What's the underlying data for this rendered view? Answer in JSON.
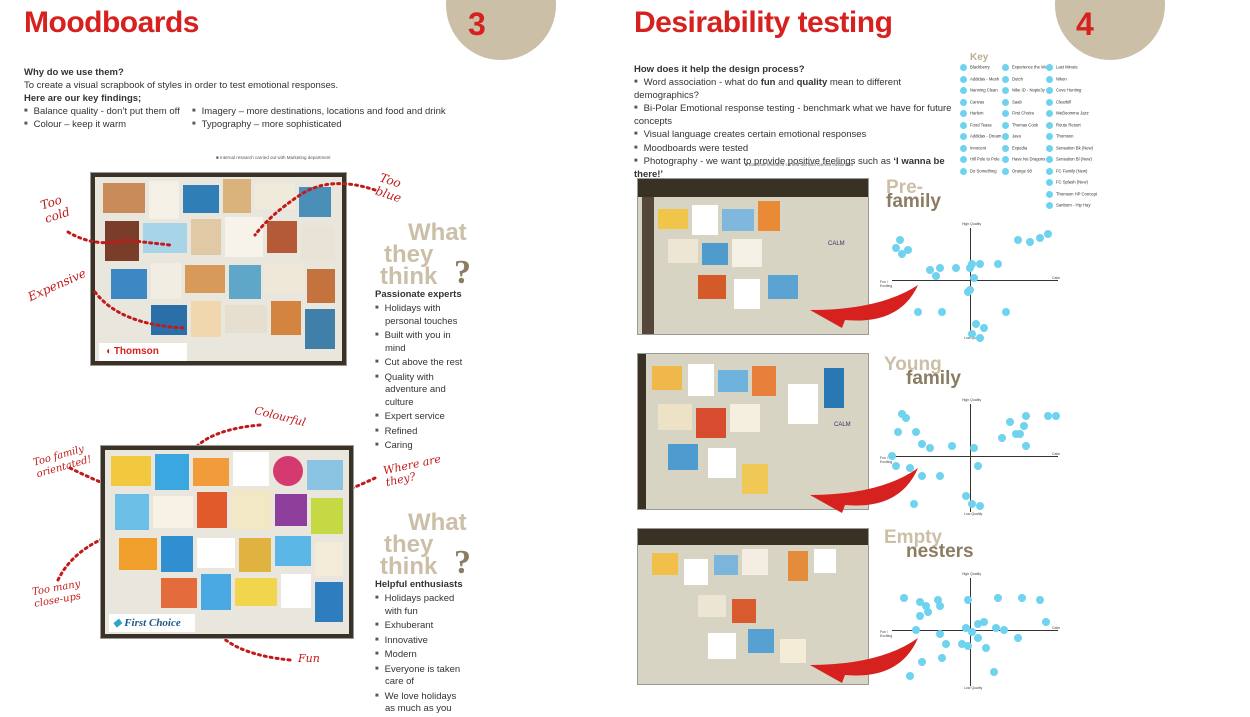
{
  "left": {
    "title": "Moodboards",
    "page_number": "3",
    "why_q": "Why do we use them?",
    "why_a": "To create a visual scrapbook of styles in order to test emotional responses.",
    "findings_label": "Here are our key findings;",
    "findings": [
      "Balance quality - don’t put them off",
      "Colour – keep it warm",
      "Imagery – more destinations, locations and food and drink",
      "Typography – more sophisticated"
    ],
    "source_note": "Internal research carried out with Marketing department",
    "board1": {
      "brand": "Thomson",
      "annotations": [
        "Too cold",
        "Too blue",
        "Expensive"
      ]
    },
    "board2": {
      "brand": "First Choice",
      "annotations": [
        "Colourful",
        "Too family orientated!",
        "Where are they?",
        "Too many close-ups",
        "Fun"
      ]
    },
    "wtt": {
      "what": "What",
      "they": "they",
      "think": "think",
      "q": "?"
    },
    "persona1": {
      "title": "Passionate experts",
      "items": [
        "Holidays with personal touches",
        "Built with you in mind",
        "Cut above the rest",
        "Quality with adventure and culture",
        "Expert service",
        "Refined",
        "Caring"
      ]
    },
    "persona2": {
      "title": "Helpful enthusiasts",
      "items": [
        "Holidays packed with fun",
        "Exhuberant",
        "Innovative",
        "Modern",
        "Everyone is taken care of",
        "We love holidays as much as you"
      ]
    }
  },
  "right": {
    "title": "Desirability testing",
    "page_number": "4",
    "how_q": "How does it help the design process?",
    "points": [
      "Word association - what do fun and quality mean to different demographics?",
      "Bi-Polar Emotional response testing - benchmark what we have for future concepts",
      "Visual language creates certain emotional responses",
      "Moodboards were tested",
      "Photography - we want to provide positive feelings such as ‘I wanna be there!’"
    ],
    "source_note": "External research carried out with current customers",
    "key_title": "Key",
    "key_col1": [
      "Blackberry",
      "Addidas - Mesh",
      "Nanning Clean",
      "Canvas",
      "Harlem",
      "Food Tease",
      "Addidas - Dream Big",
      "Innocent",
      "Hill Pole to Pole",
      "Do Something"
    ],
    "key_col2": [
      "Experience the World",
      "Dutch",
      "Nike ID - Nopie3y",
      "Saab",
      "First Choice",
      "Thomas Cook",
      "Java",
      "Expedia",
      "Have No Dragons",
      "Orange 98"
    ],
    "key_col3": [
      "Last Minute",
      "Nikon",
      "Cove Hunting",
      "Clearbill",
      "WeBoomma Jazz",
      "Route Resort",
      "Thomson",
      "Sensation Bk (New)",
      "Sensation Bl (New)",
      "FC Family (New)",
      "FC Splash (New)",
      "Thomson HP Concept",
      "Sanborn - Hip Hay"
    ],
    "segments": [
      {
        "l1": "Pre-",
        "l2": "family"
      },
      {
        "l1": "Young",
        "l2": "family"
      },
      {
        "l1": "Empty",
        "l2": "nesters"
      }
    ],
    "axes": {
      "top": "High Quality",
      "bottom": "Low Quality",
      "left": "Fun / Exciting",
      "right": "Calm"
    },
    "board_label": "CALM"
  }
}
